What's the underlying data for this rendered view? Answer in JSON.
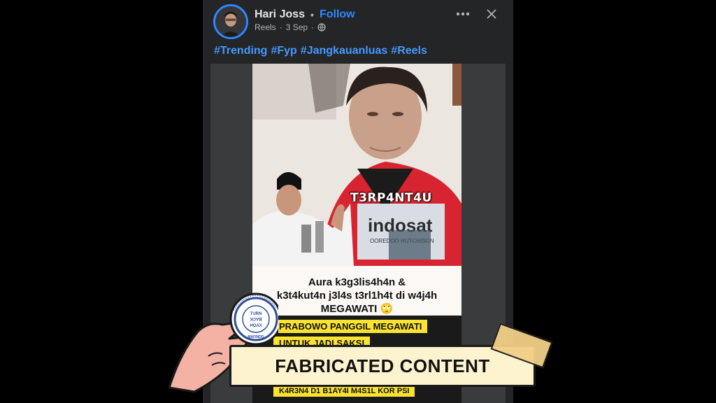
{
  "post": {
    "author_name": "Hari Joss",
    "separator": "•",
    "follow_label": "Follow",
    "meta_source": "Reels",
    "meta_dot": "·",
    "meta_date": "3 Sep",
    "meta_dot2": "·",
    "hashtags": [
      "#Trending",
      "#Fyp",
      "#Jangkauanluas",
      "#Reels"
    ]
  },
  "video": {
    "overlay_text": "T3RP4NT4U",
    "sign_text": "indosat",
    "sign_sub": "OOREDOO HUTCHISON",
    "caption_lines": [
      "Aura k3g3lis4h4n &",
      "k3t4kut4n j3l4s t3rl1h4t di w4j4h",
      "MEGAWATI 🙄"
    ],
    "banner_1": "PRABOWO PANGGIL MEGAWATI",
    "banner_2": "UNTUK JADI SAKSI",
    "banner_3": "K4R3N4 D1 B1AY4I M4S1L KOR PSI"
  },
  "stamp": {
    "ring_text": "MASYARAKAT ANTI FITNAH INDONESIA",
    "center_lines": [
      "TURN",
      "BACK",
      "HOAX"
    ],
    "org_name": "MAFINDO"
  },
  "label": {
    "text": "FABRICATED CONTENT"
  },
  "colors": {
    "follow": "#2d88ff",
    "hashtag": "#4599ff",
    "label_bg": "#fdf3cf",
    "banner": "#fbe42f"
  },
  "icons": {
    "more": "more-horizontal-icon",
    "close": "close-icon",
    "globe": "globe-icon"
  }
}
